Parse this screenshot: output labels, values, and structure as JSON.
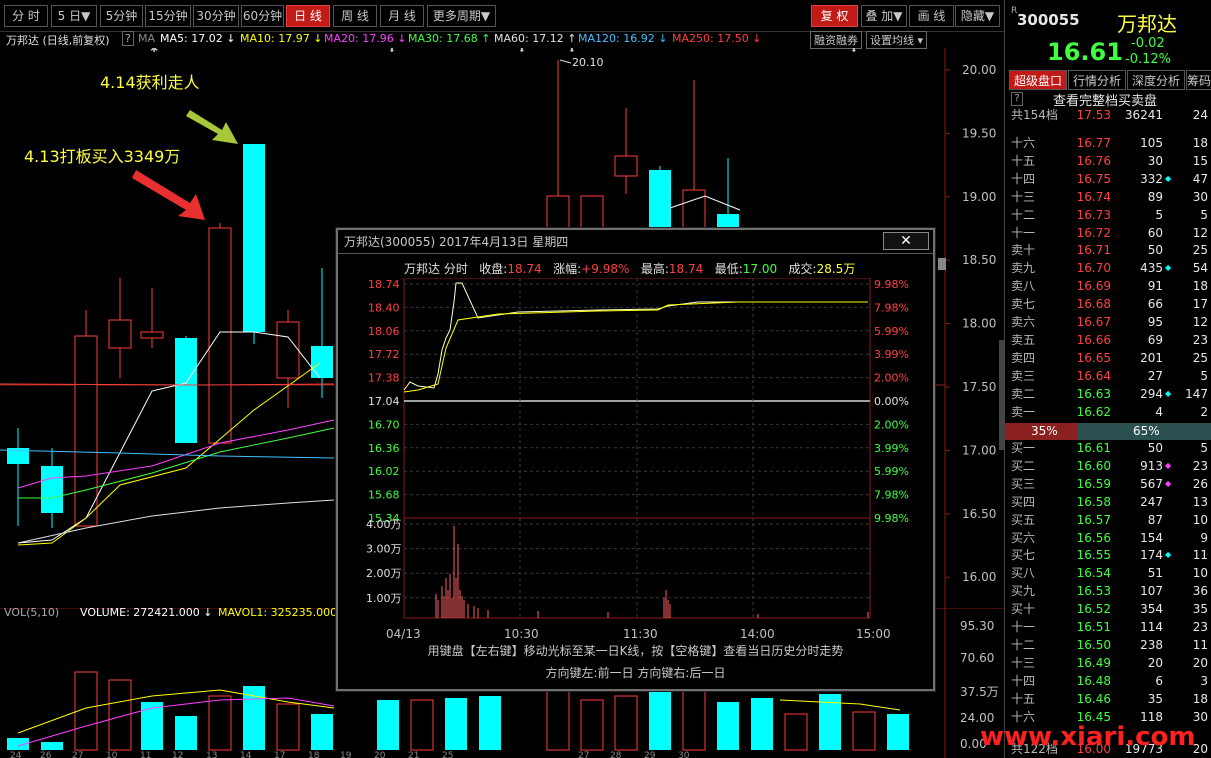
{
  "toolbar": {
    "periods": [
      "分 时",
      "5 日▼",
      "5分钟",
      "15分钟",
      "30分钟",
      "60分钟",
      "日 线",
      "周 线",
      "月 线",
      "更多周期▼"
    ],
    "active_period": "日 线",
    "right_buttons": [
      "复 权",
      "叠 加▼",
      "画 线",
      "隐藏▼"
    ],
    "active_right": "复 权"
  },
  "indicator": {
    "name": "万邦达 (日线,前复权)",
    "help": "?",
    "ma_label": "MA",
    "ma5": "MA5: 17.02 ↓",
    "ma10": "MA10: 17.97 ↓",
    "ma20": "MA20: 17.96 ↓",
    "ma30": "MA30: 17.68 ↑",
    "ma60": "MA60: 17.12 ↑",
    "ma120": "MA120: 16.92 ↓",
    "ma250": "MA250: 17.50 ↓",
    "margin_btn": "融资融券",
    "settings_btn": "设置均线 ▾"
  },
  "annotations": {
    "buy": "4.13打板买入3349万",
    "sell": "4.14获利走人",
    "high_label": "20.10"
  },
  "main_axis": {
    "ticks": [
      "20.00",
      "19.50",
      "19.00",
      "18.50",
      "18.00",
      "17.50",
      "17.00",
      "16.50",
      "16.00"
    ]
  },
  "volume": {
    "label": "VOL(5,10)",
    "volume_text": "VOLUME: 272421.000 ↓",
    "mavol_text": "MAVOL1: 325235.000",
    "ticks": [
      "95.30",
      "70.60",
      "37.5万",
      "24.00",
      "0.00"
    ],
    "date_ticks": [
      "24",
      "26",
      "27",
      "10",
      "11",
      "12",
      "13",
      "14",
      "17",
      "18",
      "19",
      "20",
      "21",
      "25",
      "27",
      "28",
      "29",
      "30"
    ]
  },
  "stock": {
    "code": "300055",
    "name": "万邦达",
    "price": "16.61",
    "change": "-0.02",
    "change_pct": "-0.12%",
    "r_mark": "R"
  },
  "tabs": [
    "超级盘口",
    "行情分析",
    "深度分析",
    "筹码"
  ],
  "orderbook_help": "?",
  "orderbook_title": "查看完整档买卖盘",
  "summary_row": {
    "label": "共154档",
    "price": "17.53",
    "vol": "36241",
    "cnt": "24"
  },
  "asks": [
    {
      "label": "十六",
      "price": "16.77",
      "vol": "105",
      "mark": "",
      "cnt": "18"
    },
    {
      "label": "十五",
      "price": "16.76",
      "vol": "30",
      "mark": "",
      "cnt": "15"
    },
    {
      "label": "十四",
      "price": "16.75",
      "vol": "332",
      "mark": "◆",
      "cnt": "47"
    },
    {
      "label": "十三",
      "price": "16.74",
      "vol": "89",
      "mark": "",
      "cnt": "30"
    },
    {
      "label": "十二",
      "price": "16.73",
      "vol": "5",
      "mark": "",
      "cnt": "5"
    },
    {
      "label": "十一",
      "price": "16.72",
      "vol": "60",
      "mark": "",
      "cnt": "12"
    },
    {
      "label": "卖十",
      "price": "16.71",
      "vol": "50",
      "mark": "",
      "cnt": "25"
    },
    {
      "label": "卖九",
      "price": "16.70",
      "vol": "435",
      "mark": "◆",
      "cnt": "54"
    },
    {
      "label": "卖八",
      "price": "16.69",
      "vol": "91",
      "mark": "",
      "cnt": "18"
    },
    {
      "label": "卖七",
      "price": "16.68",
      "vol": "66",
      "mark": "",
      "cnt": "17"
    },
    {
      "label": "卖六",
      "price": "16.67",
      "vol": "95",
      "mark": "",
      "cnt": "12"
    },
    {
      "label": "卖五",
      "price": "16.66",
      "vol": "69",
      "mark": "",
      "cnt": "23"
    },
    {
      "label": "卖四",
      "price": "16.65",
      "vol": "201",
      "mark": "",
      "cnt": "25"
    },
    {
      "label": "卖三",
      "price": "16.64",
      "vol": "27",
      "mark": "",
      "cnt": "5"
    },
    {
      "label": "卖二",
      "price": "16.63",
      "vol": "294",
      "mark": "◆",
      "cnt": "147"
    },
    {
      "label": "卖一",
      "price": "16.62",
      "vol": "4",
      "mark": "",
      "cnt": "2"
    }
  ],
  "ratio": {
    "sell": "35%",
    "buy": "65%",
    "sell_frac": 0.35
  },
  "bids": [
    {
      "label": "买一",
      "price": "16.61",
      "vol": "50",
      "mark": "",
      "cnt": "5"
    },
    {
      "label": "买二",
      "price": "16.60",
      "vol": "913",
      "mark": "◆",
      "cnt": "23"
    },
    {
      "label": "买三",
      "price": "16.59",
      "vol": "567",
      "mark": "◆",
      "cnt": "26"
    },
    {
      "label": "买四",
      "price": "16.58",
      "vol": "247",
      "mark": "",
      "cnt": "13"
    },
    {
      "label": "买五",
      "price": "16.57",
      "vol": "87",
      "mark": "",
      "cnt": "10"
    },
    {
      "label": "买六",
      "price": "16.56",
      "vol": "154",
      "mark": "",
      "cnt": "9"
    },
    {
      "label": "买七",
      "price": "16.55",
      "vol": "174",
      "mark": "◆",
      "cnt": "11"
    },
    {
      "label": "买八",
      "price": "16.54",
      "vol": "51",
      "mark": "",
      "cnt": "10"
    },
    {
      "label": "买九",
      "price": "16.53",
      "vol": "107",
      "mark": "",
      "cnt": "36"
    },
    {
      "label": "买十",
      "price": "16.52",
      "vol": "354",
      "mark": "",
      "cnt": "35"
    },
    {
      "label": "十一",
      "price": "16.51",
      "vol": "114",
      "mark": "",
      "cnt": "23"
    },
    {
      "label": "十二",
      "price": "16.50",
      "vol": "238",
      "mark": "",
      "cnt": "11"
    },
    {
      "label": "十三",
      "price": "16.49",
      "vol": "20",
      "mark": "",
      "cnt": "20"
    },
    {
      "label": "十四",
      "price": "16.48",
      "vol": "6",
      "mark": "",
      "cnt": "3"
    },
    {
      "label": "十五",
      "price": "16.46",
      "vol": "35",
      "mark": "",
      "cnt": "18"
    },
    {
      "label": "十六",
      "price": "16.45",
      "vol": "118",
      "mark": "",
      "cnt": "30"
    }
  ],
  "bottom_row": {
    "label": "共122档",
    "price": "16.00",
    "vol": "19773",
    "cnt": "20"
  },
  "watermark": "www.xiari.com",
  "popup": {
    "title": "万邦达(300055) 2017年4月13日 星期四",
    "close": "✕",
    "info_name": "万邦达 分时",
    "close_label": "收盘:",
    "close_val": "18.74",
    "chg_label": "涨幅:",
    "chg_val": "+9.98%",
    "high_label": "最高:",
    "high_val": "18.74",
    "low_label": "最低:",
    "low_val": "17.00",
    "vol_label": "成交:",
    "vol_val": "28.5万",
    "left_ticks": [
      "18.74",
      "18.40",
      "18.06",
      "17.72",
      "17.38",
      "17.04",
      "16.70",
      "16.36",
      "16.02",
      "15.68",
      "15.34"
    ],
    "right_ticks": [
      "9.98%",
      "7.98%",
      "5.99%",
      "3.99%",
      "2.00%",
      "0.00%",
      "2.00%",
      "3.99%",
      "5.99%",
      "7.98%",
      "9.98%"
    ],
    "vol_ticks": [
      "4.00万",
      "3.00万",
      "2.00万",
      "1.00万"
    ],
    "time_ticks": [
      "04/13",
      "10:30",
      "11:30",
      "14:00",
      "15:00"
    ],
    "hint1": "用键盘【左右键】移动光标至某一日K线，按【空格键】查看当日历史分时走势",
    "hint2": "方向键左:前一日   方向键右:后一日"
  },
  "colors": {
    "up": "#ff3b3b",
    "down": "#00ffff",
    "ma5": "#ffffff",
    "ma10": "#ffff00",
    "ma20": "#ff00ff",
    "ma30": "#00ff00",
    "ma60": "#ffffff",
    "ma120": "#00c0ff",
    "ma250": "#ff4040"
  }
}
